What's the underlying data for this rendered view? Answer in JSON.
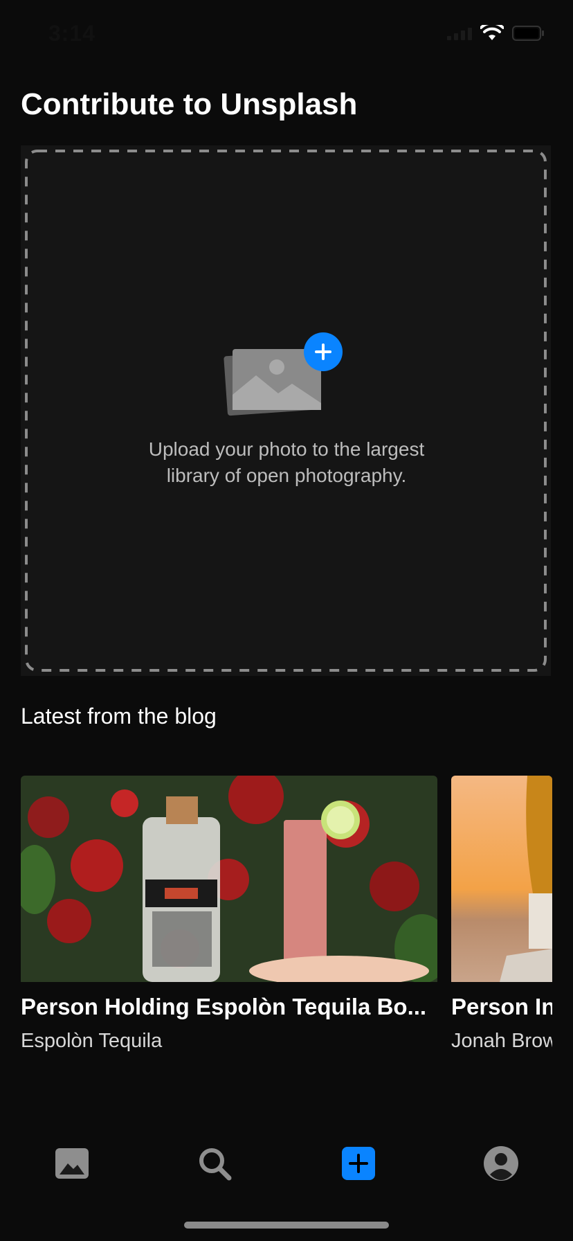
{
  "status_bar": {
    "time": "3:14"
  },
  "page": {
    "title": "Contribute to Unsplash"
  },
  "upload": {
    "line1": "Upload your photo to the largest",
    "line2": "library of open photography."
  },
  "blog": {
    "section_title": "Latest from the blog",
    "cards": [
      {
        "title": "Person Holding Espolòn Tequila Bo...",
        "author": "Espolòn Tequila"
      },
      {
        "title": "Person In",
        "author": "Jonah Brow"
      }
    ]
  },
  "tab_bar": {
    "items": [
      {
        "icon": "photos-icon",
        "active": false
      },
      {
        "icon": "search-icon",
        "active": false
      },
      {
        "icon": "add-icon",
        "active": true
      },
      {
        "icon": "profile-icon",
        "active": false
      }
    ]
  },
  "colors": {
    "accent": "#0a84ff",
    "background": "#0b0b0b",
    "panel": "#151515"
  }
}
